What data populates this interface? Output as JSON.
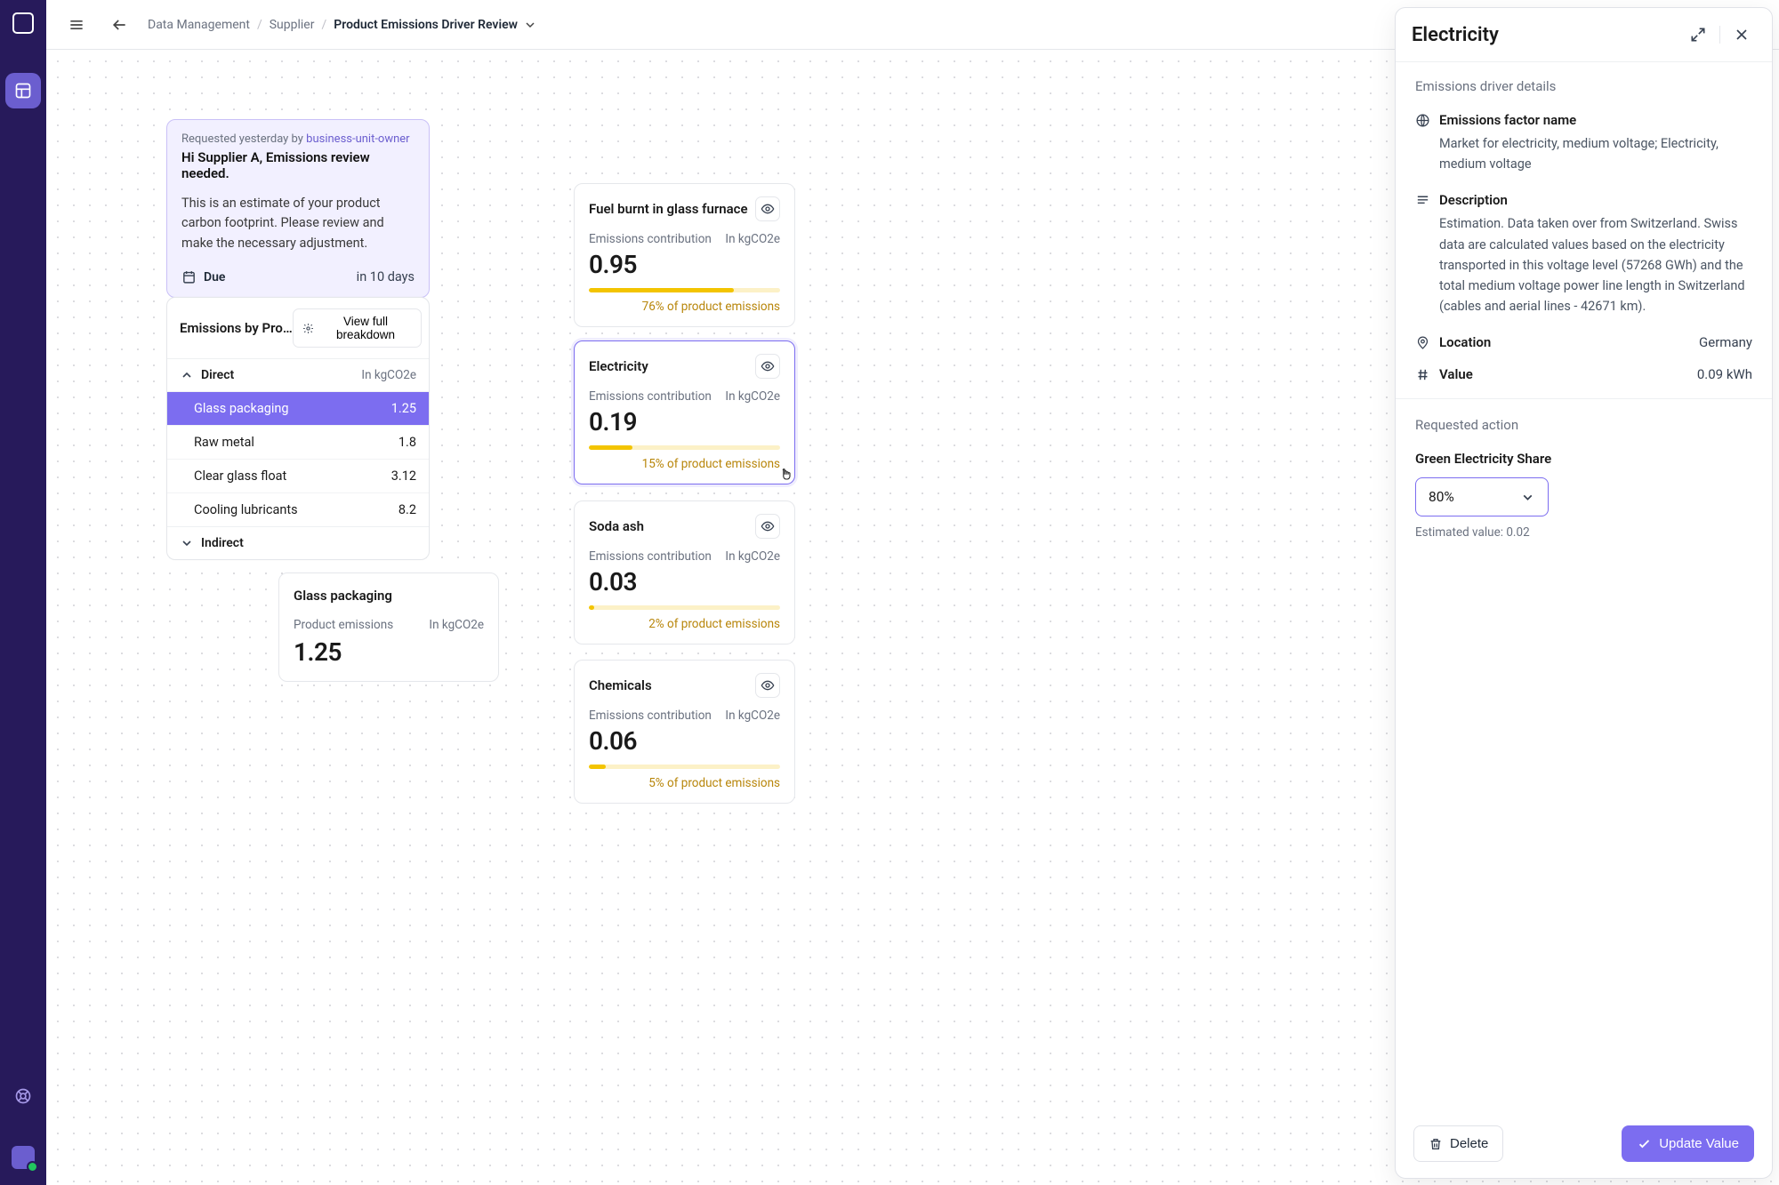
{
  "breadcrumb": {
    "a": "Data Management",
    "b": "Supplier",
    "c": "Product Emissions Driver Review"
  },
  "note": {
    "meta_prefix": "Requested yesterday by ",
    "meta_user": "business-unit-owner",
    "title": "Hi Supplier A, Emissions review needed.",
    "body": "This is an estimate of your product carbon footprint. Please review and make the necessary adjustment.",
    "due_label": "Due",
    "due_value": "in 10 days"
  },
  "panel": {
    "title": "Emissions by Product",
    "breakdown_btn": "View full breakdown",
    "direct_label": "Direct",
    "unit": "In kgCO2e",
    "indirect_label": "Indirect",
    "items": [
      {
        "name": "Glass packaging",
        "val": "1.25"
      },
      {
        "name": "Raw metal",
        "val": "1.8"
      },
      {
        "name": "Clear glass float",
        "val": "3.12"
      },
      {
        "name": "Cooling lubricants",
        "val": "8.2"
      }
    ]
  },
  "product": {
    "title": "Glass packaging",
    "sub_l": "Product emissions",
    "sub_r": "In kgCO2e",
    "value": "1.25"
  },
  "drivers_common": {
    "contribution": "Emissions contribution",
    "unit": "In kgCO2e"
  },
  "drivers": [
    {
      "title": "Fuel burnt in glass furnace",
      "value": "0.95",
      "pct_label": "76% of product emissions",
      "pct": 76
    },
    {
      "title": "Electricity",
      "value": "0.19",
      "pct_label": "15% of product emissions",
      "pct": 15
    },
    {
      "title": "Soda ash",
      "value": "0.03",
      "pct_label": "2% of product emissions",
      "pct": 2
    },
    {
      "title": "Chemicals",
      "value": "0.06",
      "pct_label": "5% of product emissions",
      "pct": 5
    }
  ],
  "drawer": {
    "title": "Electricity",
    "section": "Emissions driver details",
    "efname_label": "Emissions factor name",
    "efname_text": "Market for electricity, medium voltage; Electricity, medium voltage",
    "desc_label": "Description",
    "desc_text": "Estimation. Data taken over from Switzerland. Swiss data are calculated values based on the electricity transported in this voltage level (57268 GWh) and the total medium voltage power line length in Switzerland (cables and aerial lines - 42671 km).",
    "location_label": "Location",
    "location_value": "Germany",
    "value_label": "Value",
    "value_value": "0.09 kWh",
    "reqaction_label": "Requested action",
    "share_label": "Green Electricity Share",
    "share_selected": "80%",
    "helper_text": "Estimated value: 0.02",
    "delete_btn": "Delete",
    "update_btn": "Update Value"
  }
}
